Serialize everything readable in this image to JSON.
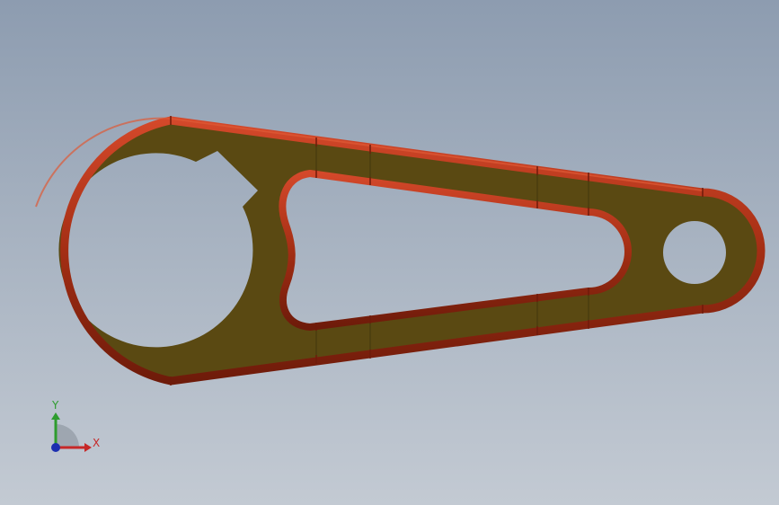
{
  "colors": {
    "face": "#5a4912",
    "face_light": "#6a5618",
    "edge_fillet": "#b8361a",
    "edge_fillet_dark": "#6e1b0a",
    "background_top": "#8d9cb0",
    "background_bottom": "#c3cad3",
    "axis_x": "#c62828",
    "axis_y": "#2e9c2e",
    "axis_z": "#1c2fb0"
  },
  "triad": {
    "x_label": "X",
    "y_label": "Y"
  },
  "model": {
    "part_name": "",
    "icons": [
      "coordinate-triad-icon"
    ]
  }
}
